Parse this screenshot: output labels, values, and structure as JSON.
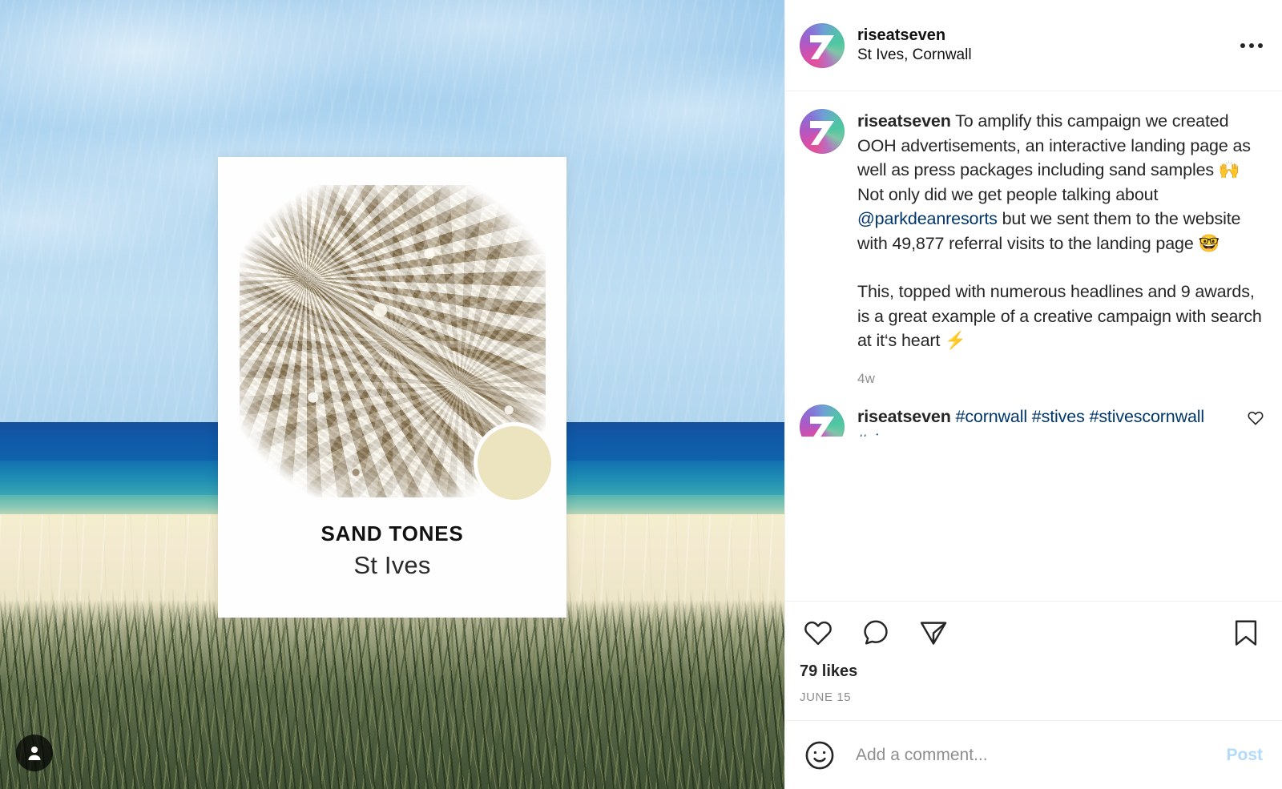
{
  "post": {
    "header": {
      "username": "riseatseven",
      "location": "St Ives, Cornwall",
      "more_label": "More options"
    },
    "media": {
      "poster": {
        "title": "SAND TONES",
        "subtitle": "St Ives",
        "swatch_color": "#ece3bf",
        "sand_color": "#d4c6a8"
      },
      "scene": {
        "sky_color": "#b6d9f1",
        "deep_sea_color": "#1059a8",
        "shallow_sea_color": "#3fa9b3",
        "beach_color": "#f0e8ca",
        "grass_color": "#5e6e4c"
      },
      "tag_badge": "person-icon"
    },
    "caption": {
      "author": "riseatseven",
      "paragraph_1_pre_mention": "To amplify this campaign we created OOH advertisements, an interactive landing page as well as press packages including sand samples 🙌 Not only did we get people talking about ",
      "mention": "@parkdeanresorts",
      "paragraph_1_post_mention": " but we sent them to the website with 49,877 referral visits to the landing page 🤓",
      "paragraph_2": "This, topped with numerous headlines and 9 awards, is a great example of a creative campaign with search at it‘s heart ⚡",
      "time_ago": "4w"
    },
    "comment": {
      "author": "riseatseven",
      "hashtags_line_1": "#cornwall #stives",
      "hashtags_line_2": "#stivescornwall #vis"
    },
    "actions": {
      "like": "heart-icon",
      "comment": "comment-icon",
      "share": "share-icon",
      "save": "bookmark-icon"
    },
    "likes_count": "79 likes",
    "date": "JUNE 15",
    "add_comment": {
      "placeholder": "Add a comment...",
      "value": "",
      "post_label": "Post",
      "emoji": "smiley-icon"
    }
  },
  "colors": {
    "link": "#00376b",
    "muted": "#8e8e8e",
    "post_button": "#b2dafb",
    "text": "#262626"
  }
}
